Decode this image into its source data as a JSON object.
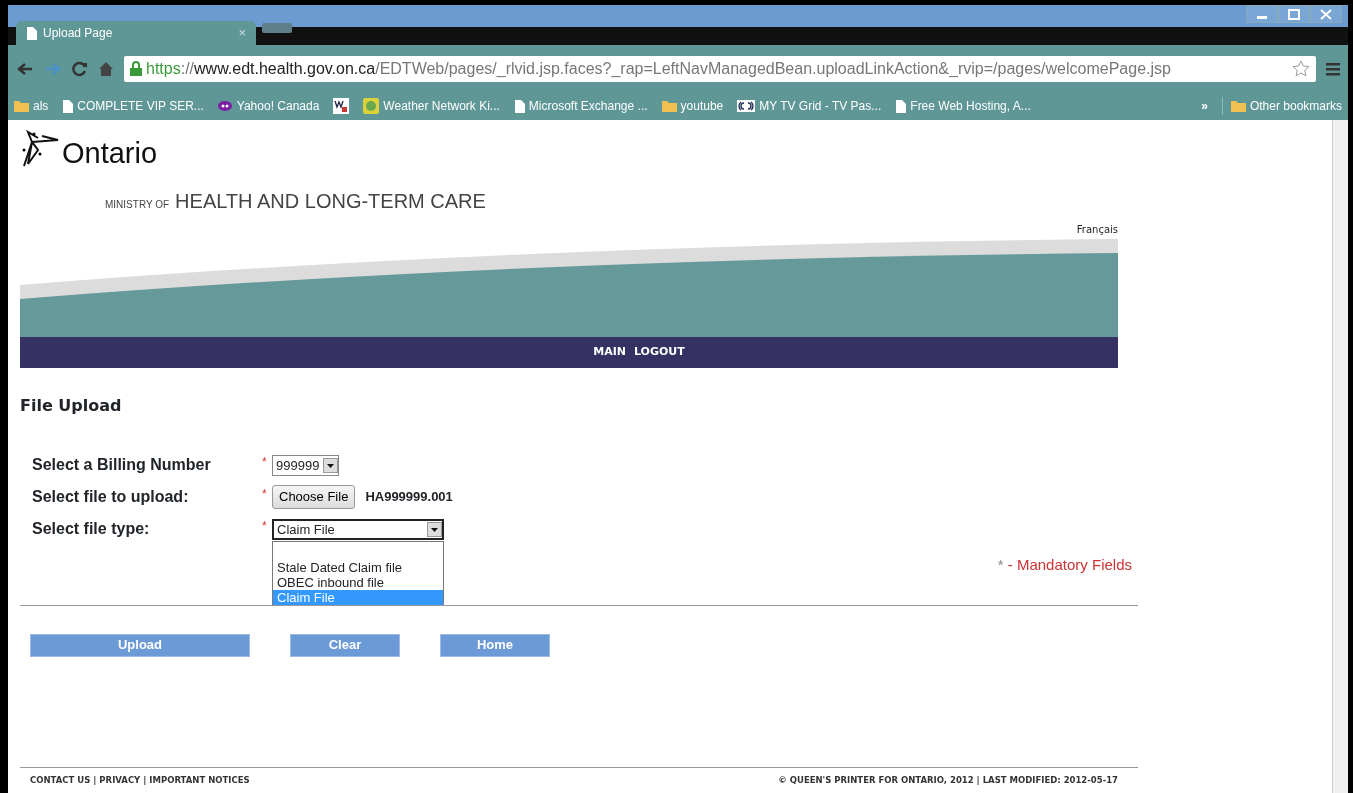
{
  "tabs": [
    {
      "label": "Upload Page",
      "close": "×",
      "selected": true
    }
  ],
  "address_bar": {
    "scheme": "https",
    "separator": "://",
    "host": "www.edt.health.gov.on.ca",
    "path": "/EDTWeb/pages/_rlvid.jsp.faces?_rap=LeftNavManagedBean.uploadLinkAction&_rvip=/pages/welcomePage.jsp",
    "secure": true
  },
  "bookmarks": [
    {
      "label": "als",
      "kind": "folder"
    },
    {
      "label": "COMPLETE VIP SER...",
      "kind": "page"
    },
    {
      "label": "Yahoo! Canada",
      "kind": "yahoo"
    },
    {
      "kind": "wr"
    },
    {
      "label": "Weather Network Ki...",
      "kind": "weather"
    },
    {
      "label": "Microsoft Exchange ...",
      "kind": "page"
    },
    {
      "label": "youtube",
      "kind": "folder"
    },
    {
      "label": "MY TV Grid - TV Pas...",
      "kind": "tv"
    },
    {
      "label": "Free Web Hosting, A...",
      "kind": "page"
    }
  ],
  "bookmarks_overflow": "»",
  "other_bookmarks": "Other bookmarks",
  "header": {
    "logo_text": "Ontario",
    "ministry_prefix": "MINISTRY OF",
    "ministry": "HEALTH AND LONG-TERM CARE",
    "language_link": "Français"
  },
  "nav": [
    "MAIN",
    "LOGOUT"
  ],
  "heading": "File Upload",
  "fields": [
    {
      "label": "Select a Billing Number",
      "kind": "select",
      "required_mark": "*",
      "value": "999999"
    },
    {
      "label": "Select file to upload:",
      "kind": "file",
      "required_mark": "*",
      "button": "Choose File",
      "value": "HA999999.001"
    },
    {
      "label": "Select file type:",
      "kind": "select",
      "required_mark": "*",
      "value": "Claim File",
      "expanded": true,
      "options": [
        {
          "label": "Stale Dated Claim file",
          "selected": false
        },
        {
          "label": "OBEC inbound file",
          "selected": false
        },
        {
          "label": "Claim File",
          "selected": true
        }
      ]
    }
  ],
  "mandatory_note": {
    "mark": "*",
    "text": "- Mandatory Fields"
  },
  "buttons": [
    "Upload",
    "Clear",
    "Home"
  ],
  "footer": {
    "links": [
      "CONTACT US",
      "PRIVACY",
      "IMPORTANT NOTICES"
    ],
    "separator": "|",
    "copyright": "© QUEEN'S PRINTER FOR ONTARIO, 2012 | LAST MODIFIED:  2012-05-17"
  }
}
